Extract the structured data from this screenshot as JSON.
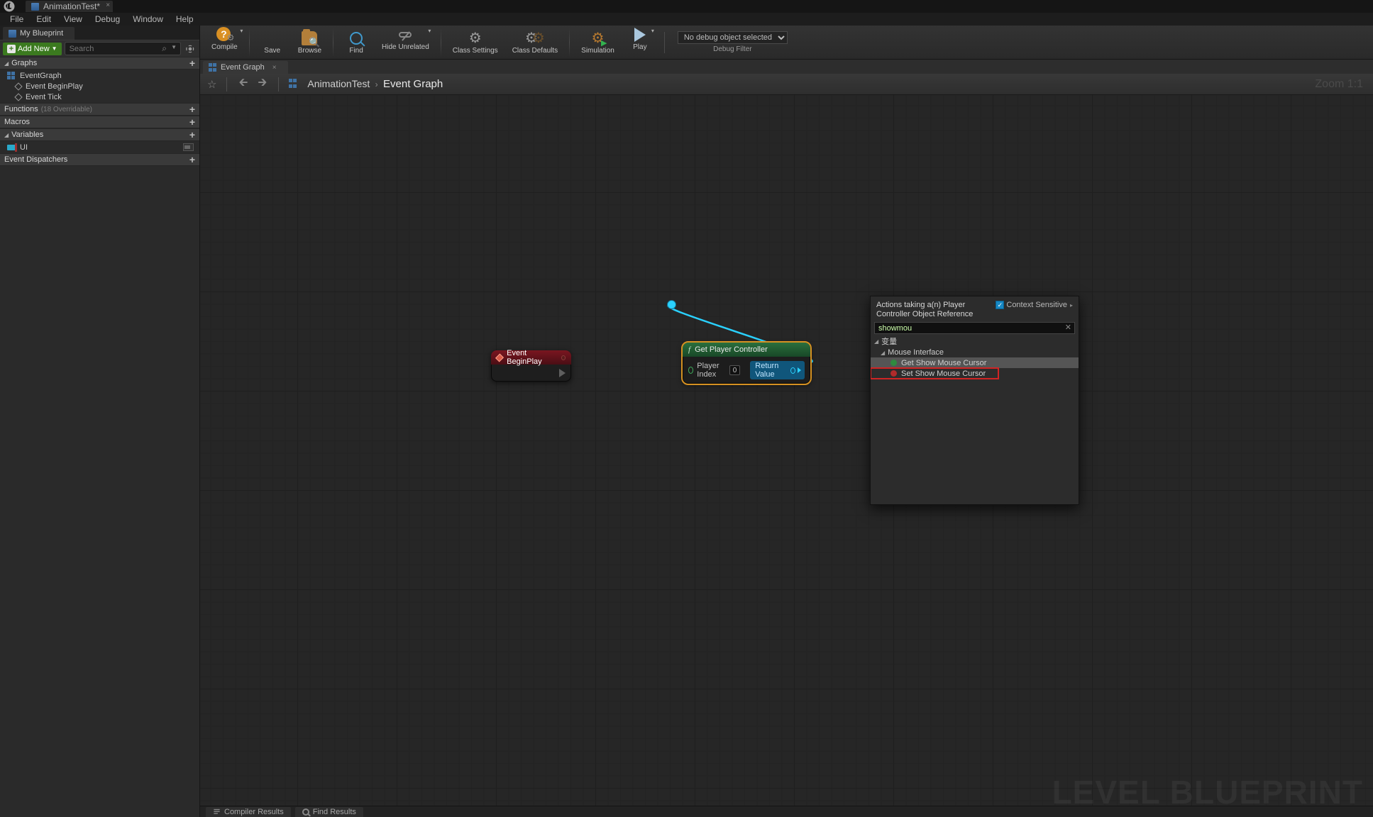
{
  "window": {
    "title": "AnimationTest*"
  },
  "menu": {
    "items": [
      "File",
      "Edit",
      "View",
      "Debug",
      "Window",
      "Help"
    ]
  },
  "left_panel": {
    "tab": "My Blueprint",
    "add_new": "Add New",
    "search_placeholder": "Search",
    "sections": {
      "graphs": "Graphs",
      "functions": "Functions",
      "functions_note": "(18 Overridable)",
      "macros": "Macros",
      "variables": "Variables",
      "dispatchers": "Event Dispatchers"
    },
    "graph_tree": {
      "root": "EventGraph",
      "children": [
        "Event BeginPlay",
        "Event Tick"
      ]
    },
    "variables": [
      "UI"
    ]
  },
  "toolbar": {
    "compile": "Compile",
    "save": "Save",
    "browse": "Browse",
    "find": "Find",
    "hide_unrelated": "Hide Unrelated",
    "class_settings": "Class Settings",
    "class_defaults": "Class Defaults",
    "simulation": "Simulation",
    "play": "Play",
    "debug_selected": "No debug object selected",
    "debug_label": "Debug Filter"
  },
  "graph_area": {
    "tab": "Event Graph",
    "breadcrumb": {
      "root": "AnimationTest",
      "leaf": "Event Graph"
    },
    "zoom": "Zoom 1:1",
    "watermark": "LEVEL BLUEPRINT"
  },
  "nodes": {
    "event_begin": {
      "title": "Event BeginPlay"
    },
    "get_pc": {
      "title": "Get Player Controller",
      "in_pin": "Player Index",
      "in_val": "0",
      "out_pin": "Return Value"
    }
  },
  "context_menu": {
    "title": "Actions taking a(n) Player Controller Object Reference",
    "context_sensitive": "Context Sensitive",
    "search_value": "showmou",
    "categories": {
      "var": "变量",
      "mouse": "Mouse Interface"
    },
    "items": {
      "get_show": "Get Show Mouse Cursor",
      "set_show": "Set Show Mouse Cursor"
    }
  },
  "status": {
    "compiler_results": "Compiler Results",
    "find_results": "Find Results"
  }
}
